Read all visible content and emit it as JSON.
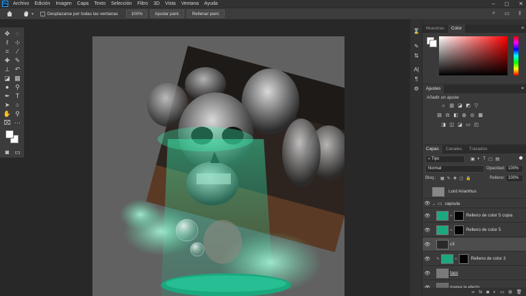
{
  "menubar": {
    "logo": "Ps",
    "items": [
      "Archivo",
      "Edición",
      "Imagen",
      "Capa",
      "Texto",
      "Selección",
      "Filtro",
      "3D",
      "Vista",
      "Ventana",
      "Ayuda"
    ],
    "window_controls": [
      "–",
      "◻",
      "✕"
    ]
  },
  "options": {
    "scroll_all_label": "Desplazarse por todas las ventanas",
    "zoom_btn": "100%",
    "fit_btn": "Ajustar pant.",
    "fill_btn": "Rellenar pant."
  },
  "color_tabs": [
    "Muestras",
    "Color"
  ],
  "adjustments": {
    "tab": "Ajustes",
    "hint": "Añadir un ajuste"
  },
  "layers": {
    "tabs": [
      "Capas",
      "Canales",
      "Trazados"
    ],
    "kind_filter": "Tipo",
    "blend_mode": "Normal",
    "opacity_label": "Opacidad:",
    "opacity_value": "100%",
    "lock_label": "Bloq.:",
    "fill_label": "Relleno:",
    "fill_value": "100%",
    "items": [
      {
        "name": "Lord Arianthus"
      },
      {
        "name": "capsula"
      },
      {
        "name": "Relleno de color 5 copia"
      },
      {
        "name": "Relleno de color 5"
      },
      {
        "name": "c3"
      },
      {
        "name": "Relleno de color 3"
      },
      {
        "name": "taps"
      },
      {
        "name": "marea la efecto"
      }
    ]
  },
  "colors": {
    "teal": "#1aa97f",
    "glow": "#3df0b0",
    "accent": "#31a8ff"
  }
}
